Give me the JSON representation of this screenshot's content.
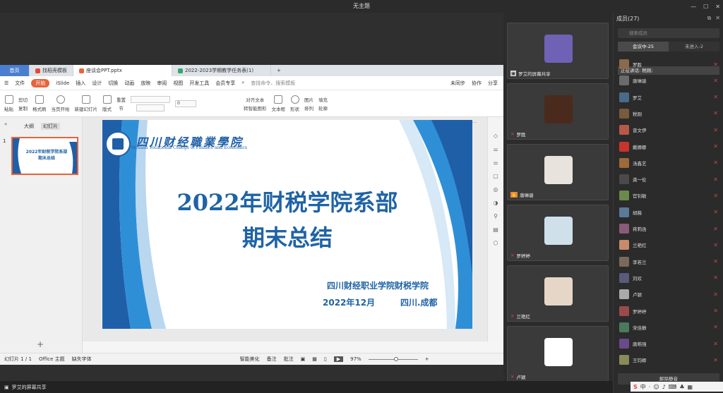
{
  "window": {
    "title": "无主题"
  },
  "wps": {
    "tabs": [
      {
        "label": "首页"
      },
      {
        "label": "找稻壳模板"
      },
      {
        "label": "座谈会PPT.pptx"
      },
      {
        "label": "2022-2023学期教学任务表(1)"
      }
    ],
    "menu": [
      "文件",
      "开始",
      "iSlide",
      "插入",
      "设计",
      "切换",
      "动画",
      "放映",
      "审阅",
      "视图",
      "开发工具",
      "会员专享"
    ],
    "search_placeholder": "查找命令、搜索模板",
    "menu_right": [
      "未同步",
      "协作",
      "分享"
    ],
    "ribbon": {
      "paste": "粘贴",
      "cut": "剪切",
      "copy": "复制",
      "format_painter": "格式刷",
      "play_from_current": "当页开始",
      "new_slide": "新建幻灯片",
      "layout": "版式",
      "section": "节",
      "reset": "重置",
      "font_size": "0",
      "align_text": "对齐文本",
      "convert_smartart": "转智能图形",
      "textbox": "文本框",
      "shape": "形状",
      "arrange": "排列",
      "picture": "图片",
      "fill": "填充",
      "outline": "轮廓"
    },
    "left_tabs": [
      "大纲",
      "幻灯片"
    ],
    "status": {
      "slide_count": "幻灯片 1 / 1",
      "theme": "Office 主题",
      "missing_font": "缺失字体",
      "beautify": "智能美化",
      "notes": "备注",
      "comment": "批注",
      "zoom": "97%"
    }
  },
  "slide": {
    "school_cn": "四川财经職業學院",
    "school_en": "Sichuan Vocational College of Finance and Economics",
    "title_line1": "2022年财税学院系部",
    "title_line2": "期末总结",
    "org": "四川财经职业学院财税学院",
    "date": "2022年12月",
    "place": "四川.成都",
    "thumb_title1": "2022年财税学院系部",
    "thumb_title2": "期末总结"
  },
  "videos": [
    {
      "name": "罗艾的屏幕共享"
    },
    {
      "name": "罗胜"
    },
    {
      "name": "唐琳骏"
    },
    {
      "name": "罗婷婷"
    },
    {
      "name": "兰艳红"
    },
    {
      "name": "卢颖"
    }
  ],
  "members": {
    "title": "成员(27)",
    "search_placeholder": "搜索成员",
    "tab_in": "会议中-25",
    "tab_out": "未进入-2",
    "speaking": "正在讲话: 税刚;",
    "list": [
      {
        "name": "罗胜"
      },
      {
        "name": "唐琳骏"
      },
      {
        "name": "罗艾"
      },
      {
        "name": "税刚"
      },
      {
        "name": "曾文伊"
      },
      {
        "name": "戴娜娜"
      },
      {
        "name": "汤鑫艺"
      },
      {
        "name": "龚一伦"
      },
      {
        "name": "官钊敏"
      },
      {
        "name": "胡薇"
      },
      {
        "name": "蒋莉函"
      },
      {
        "name": "兰艳红"
      },
      {
        "name": "李若兰"
      },
      {
        "name": "刘欢"
      },
      {
        "name": "卢颖"
      },
      {
        "name": "罗婷婷"
      },
      {
        "name": "宋佳静"
      },
      {
        "name": "唐皓强"
      },
      {
        "name": "王钧卿"
      }
    ],
    "unmute": "解除静音"
  },
  "bottom": {
    "share_label": "罗艾的屏幕共享"
  },
  "colors": {
    "accent": "#1f63a6",
    "start": "#e8633a"
  }
}
